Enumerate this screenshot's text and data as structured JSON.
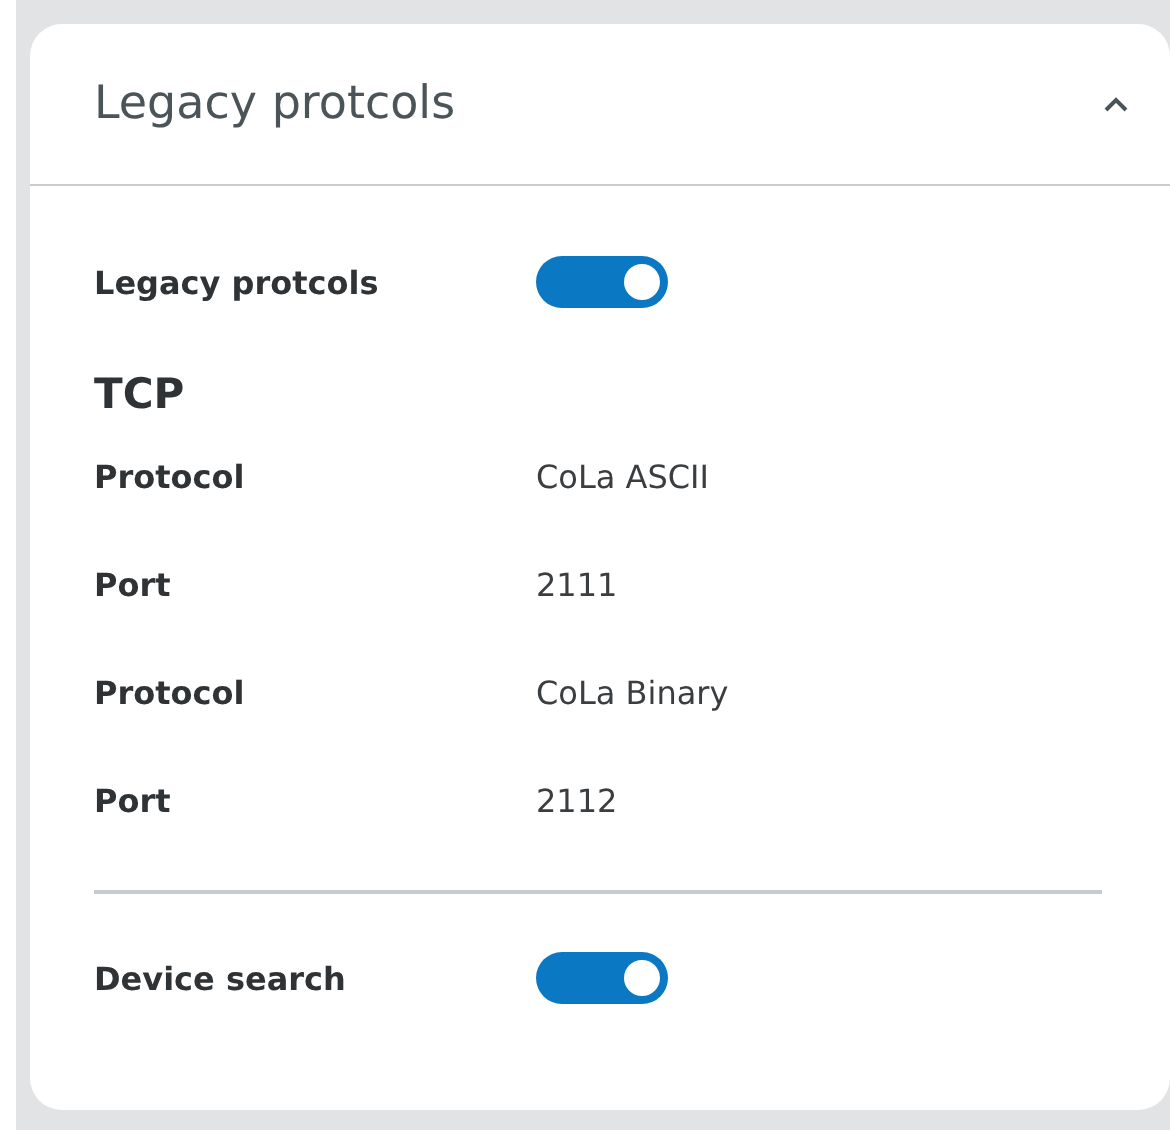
{
  "panel": {
    "title": "Legacy protcols",
    "expanded": true,
    "sections": [
      {
        "rows": [
          {
            "kind": "toggle",
            "label": "Legacy protcols",
            "on": true
          },
          {
            "kind": "heading",
            "label": "TCP"
          },
          {
            "kind": "field",
            "label": "Protocol",
            "value": "CoLa ASCII"
          },
          {
            "kind": "field",
            "label": "Port",
            "value": "2111"
          },
          {
            "kind": "field",
            "label": "Protocol",
            "value": "CoLa Binary"
          },
          {
            "kind": "field",
            "label": "Port",
            "value": "2112"
          }
        ]
      },
      {
        "rows": [
          {
            "kind": "toggle",
            "label": "Device search",
            "on": true
          }
        ]
      }
    ]
  }
}
